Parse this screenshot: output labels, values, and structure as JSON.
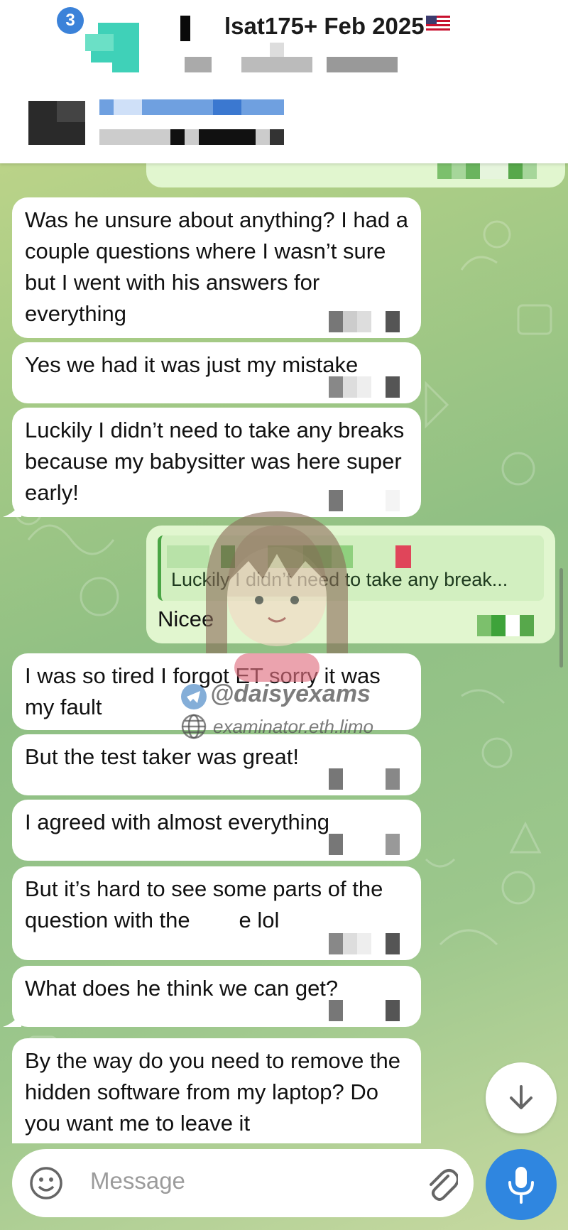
{
  "header": {
    "unread_count": "3",
    "title": "lsat175+ Feb 2025"
  },
  "messages": [
    {
      "text": "Was he unsure about anything? I had a couple questions where I wasn’t sure but I went with his answers for everything"
    },
    {
      "text": "Yes we had it was just my mistake"
    },
    {
      "text": "Luckily I didn’t need to take any breaks because my babysitter was here super early!"
    },
    {
      "reply_quote": "Luckily I didn’t need to take any break...",
      "text": "Nicee"
    },
    {
      "text": "I was so tired I forgot ET sorry it was my fault"
    },
    {
      "text": "But the test taker was great!"
    },
    {
      "text": "I agreed with almost everything"
    },
    {
      "text": "But it’s hard to see some parts of the question with the        e lol"
    },
    {
      "text": "What does he think we can get?"
    },
    {
      "text": "By the way do you need to remove the hidden software from my laptop? Do you want me to leave it"
    }
  ],
  "watermark": {
    "handle": "@daisyexams",
    "site": "examinator.eth.limo"
  },
  "composer": {
    "placeholder": "Message"
  },
  "colors": {
    "accent": "#2f86e0",
    "outgoing_bubble": "#e1f6cf",
    "incoming_bubble": "#ffffff"
  }
}
